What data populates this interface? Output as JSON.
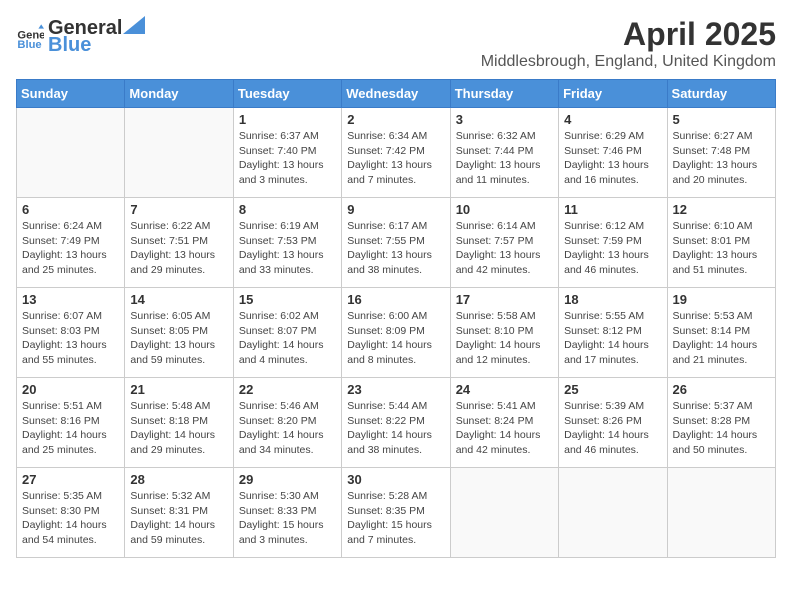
{
  "header": {
    "logo_general": "General",
    "logo_blue": "Blue",
    "month": "April 2025",
    "location": "Middlesbrough, England, United Kingdom"
  },
  "days_of_week": [
    "Sunday",
    "Monday",
    "Tuesday",
    "Wednesday",
    "Thursday",
    "Friday",
    "Saturday"
  ],
  "weeks": [
    [
      {
        "day": "",
        "info": ""
      },
      {
        "day": "",
        "info": ""
      },
      {
        "day": "1",
        "info": "Sunrise: 6:37 AM\nSunset: 7:40 PM\nDaylight: 13 hours and 3 minutes."
      },
      {
        "day": "2",
        "info": "Sunrise: 6:34 AM\nSunset: 7:42 PM\nDaylight: 13 hours and 7 minutes."
      },
      {
        "day": "3",
        "info": "Sunrise: 6:32 AM\nSunset: 7:44 PM\nDaylight: 13 hours and 11 minutes."
      },
      {
        "day": "4",
        "info": "Sunrise: 6:29 AM\nSunset: 7:46 PM\nDaylight: 13 hours and 16 minutes."
      },
      {
        "day": "5",
        "info": "Sunrise: 6:27 AM\nSunset: 7:48 PM\nDaylight: 13 hours and 20 minutes."
      }
    ],
    [
      {
        "day": "6",
        "info": "Sunrise: 6:24 AM\nSunset: 7:49 PM\nDaylight: 13 hours and 25 minutes."
      },
      {
        "day": "7",
        "info": "Sunrise: 6:22 AM\nSunset: 7:51 PM\nDaylight: 13 hours and 29 minutes."
      },
      {
        "day": "8",
        "info": "Sunrise: 6:19 AM\nSunset: 7:53 PM\nDaylight: 13 hours and 33 minutes."
      },
      {
        "day": "9",
        "info": "Sunrise: 6:17 AM\nSunset: 7:55 PM\nDaylight: 13 hours and 38 minutes."
      },
      {
        "day": "10",
        "info": "Sunrise: 6:14 AM\nSunset: 7:57 PM\nDaylight: 13 hours and 42 minutes."
      },
      {
        "day": "11",
        "info": "Sunrise: 6:12 AM\nSunset: 7:59 PM\nDaylight: 13 hours and 46 minutes."
      },
      {
        "day": "12",
        "info": "Sunrise: 6:10 AM\nSunset: 8:01 PM\nDaylight: 13 hours and 51 minutes."
      }
    ],
    [
      {
        "day": "13",
        "info": "Sunrise: 6:07 AM\nSunset: 8:03 PM\nDaylight: 13 hours and 55 minutes."
      },
      {
        "day": "14",
        "info": "Sunrise: 6:05 AM\nSunset: 8:05 PM\nDaylight: 13 hours and 59 minutes."
      },
      {
        "day": "15",
        "info": "Sunrise: 6:02 AM\nSunset: 8:07 PM\nDaylight: 14 hours and 4 minutes."
      },
      {
        "day": "16",
        "info": "Sunrise: 6:00 AM\nSunset: 8:09 PM\nDaylight: 14 hours and 8 minutes."
      },
      {
        "day": "17",
        "info": "Sunrise: 5:58 AM\nSunset: 8:10 PM\nDaylight: 14 hours and 12 minutes."
      },
      {
        "day": "18",
        "info": "Sunrise: 5:55 AM\nSunset: 8:12 PM\nDaylight: 14 hours and 17 minutes."
      },
      {
        "day": "19",
        "info": "Sunrise: 5:53 AM\nSunset: 8:14 PM\nDaylight: 14 hours and 21 minutes."
      }
    ],
    [
      {
        "day": "20",
        "info": "Sunrise: 5:51 AM\nSunset: 8:16 PM\nDaylight: 14 hours and 25 minutes."
      },
      {
        "day": "21",
        "info": "Sunrise: 5:48 AM\nSunset: 8:18 PM\nDaylight: 14 hours and 29 minutes."
      },
      {
        "day": "22",
        "info": "Sunrise: 5:46 AM\nSunset: 8:20 PM\nDaylight: 14 hours and 34 minutes."
      },
      {
        "day": "23",
        "info": "Sunrise: 5:44 AM\nSunset: 8:22 PM\nDaylight: 14 hours and 38 minutes."
      },
      {
        "day": "24",
        "info": "Sunrise: 5:41 AM\nSunset: 8:24 PM\nDaylight: 14 hours and 42 minutes."
      },
      {
        "day": "25",
        "info": "Sunrise: 5:39 AM\nSunset: 8:26 PM\nDaylight: 14 hours and 46 minutes."
      },
      {
        "day": "26",
        "info": "Sunrise: 5:37 AM\nSunset: 8:28 PM\nDaylight: 14 hours and 50 minutes."
      }
    ],
    [
      {
        "day": "27",
        "info": "Sunrise: 5:35 AM\nSunset: 8:30 PM\nDaylight: 14 hours and 54 minutes."
      },
      {
        "day": "28",
        "info": "Sunrise: 5:32 AM\nSunset: 8:31 PM\nDaylight: 14 hours and 59 minutes."
      },
      {
        "day": "29",
        "info": "Sunrise: 5:30 AM\nSunset: 8:33 PM\nDaylight: 15 hours and 3 minutes."
      },
      {
        "day": "30",
        "info": "Sunrise: 5:28 AM\nSunset: 8:35 PM\nDaylight: 15 hours and 7 minutes."
      },
      {
        "day": "",
        "info": ""
      },
      {
        "day": "",
        "info": ""
      },
      {
        "day": "",
        "info": ""
      }
    ]
  ]
}
